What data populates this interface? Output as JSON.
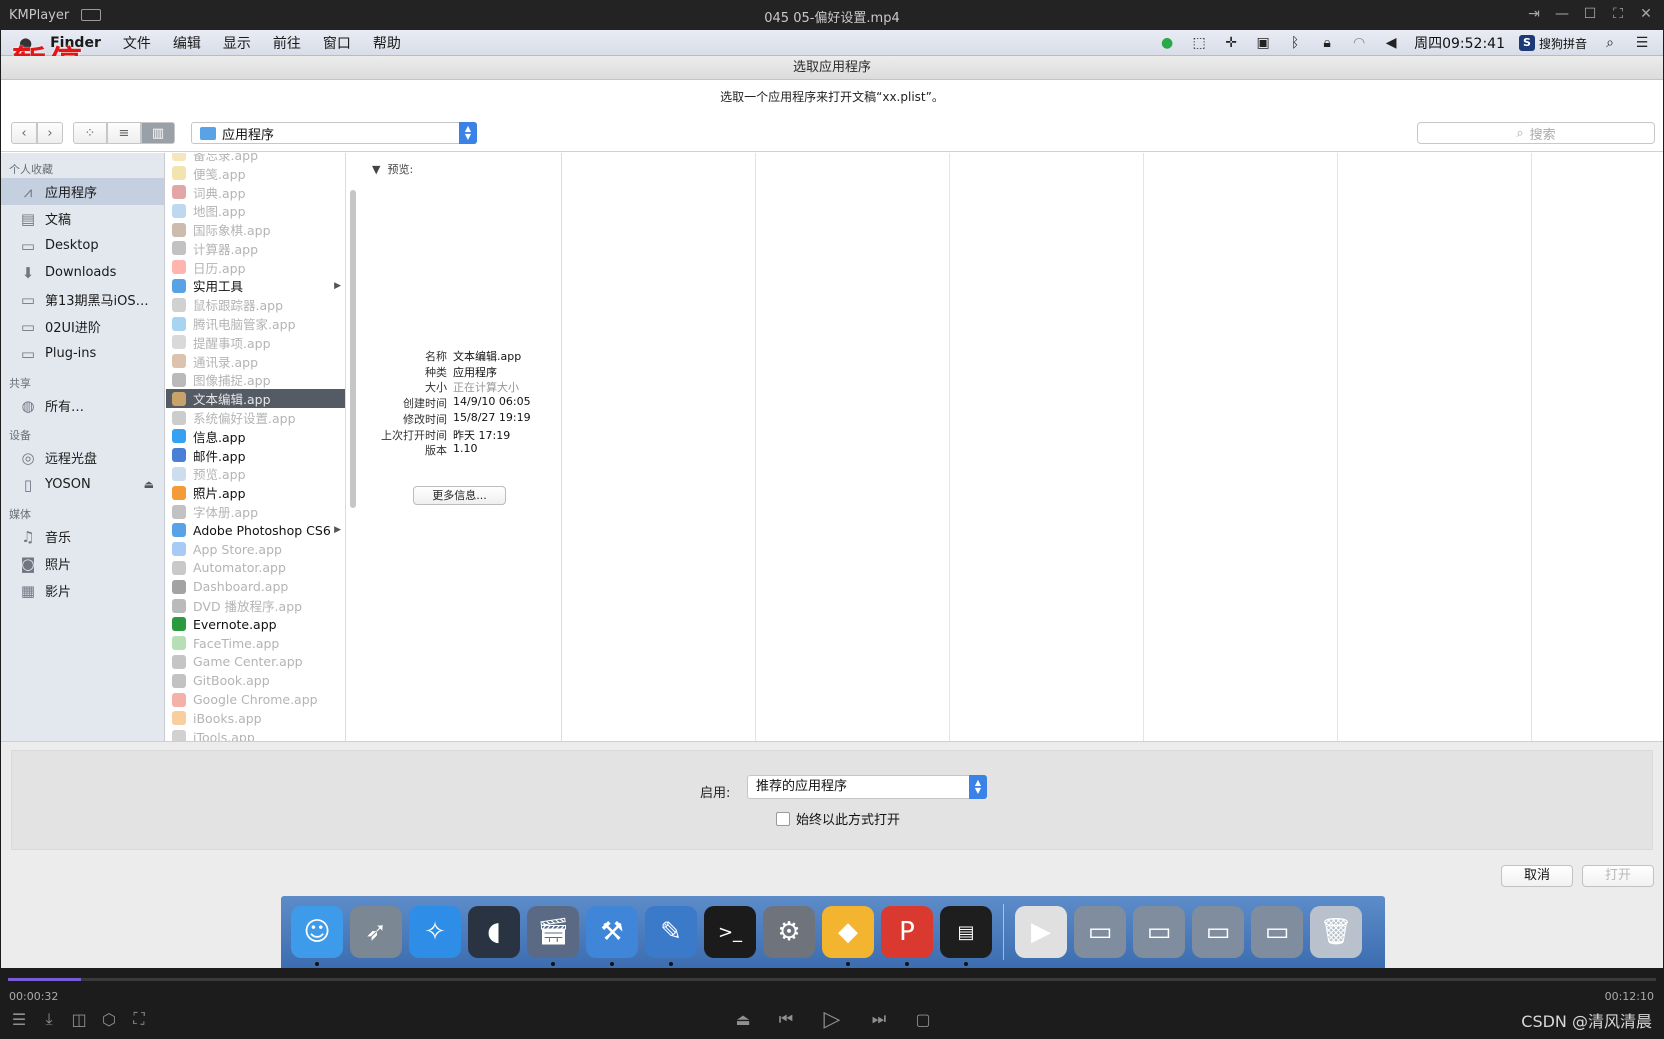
{
  "player": {
    "brand": "KMPlayer",
    "video_title": "045 05-偏好设置.mp4",
    "time_current": "00:00:32",
    "time_total": "00:12:10",
    "progress": 0.044,
    "watermark": "CSDN @清风清晨"
  },
  "overlay": {
    "pause": "暂停"
  },
  "menubar": {
    "app": "Finder",
    "items": [
      "文件",
      "编辑",
      "显示",
      "前往",
      "窗口",
      "帮助"
    ],
    "clock": "周四09:52:41",
    "ime": "搜狗拼音"
  },
  "dialog": {
    "title": "选取应用程序",
    "prompt": "选取一个应用程序来打开文稿“xx.plist”。",
    "location": "应用程序",
    "search_placeholder": "搜索"
  },
  "sidebar": {
    "favorites_header": "个人收藏",
    "favorites": [
      "应用程序",
      "文稿",
      "Desktop",
      "Downloads",
      "第13期黑马iOS…",
      "02UI进阶",
      "Plug-ins"
    ],
    "shared_header": "共享",
    "shared": [
      "所有…"
    ],
    "devices_header": "设备",
    "devices": [
      "远程光盘",
      "YOSON"
    ],
    "media_header": "媒体",
    "media": [
      "音乐",
      "照片",
      "影片"
    ]
  },
  "files": [
    {
      "name": "备忘录.app",
      "dim": true
    },
    {
      "name": "便笺.app",
      "dim": true
    },
    {
      "name": "词典.app",
      "dim": true
    },
    {
      "name": "地图.app",
      "dim": true
    },
    {
      "name": "国际象棋.app",
      "dim": true
    },
    {
      "name": "计算器.app",
      "dim": true
    },
    {
      "name": "日历.app",
      "dim": true
    },
    {
      "name": "实用工具",
      "dim": false,
      "folder": true
    },
    {
      "name": "鼠标跟踪器.app",
      "dim": true
    },
    {
      "name": "腾讯电脑管家.app",
      "dim": true
    },
    {
      "name": "提醒事项.app",
      "dim": true
    },
    {
      "name": "通讯录.app",
      "dim": true
    },
    {
      "name": "图像捕捉.app",
      "dim": true
    },
    {
      "name": "文本编辑.app",
      "dim": false,
      "selected": true
    },
    {
      "name": "系统偏好设置.app",
      "dim": true
    },
    {
      "name": "信息.app",
      "dim": false
    },
    {
      "name": "邮件.app",
      "dim": false
    },
    {
      "name": "预览.app",
      "dim": true
    },
    {
      "name": "照片.app",
      "dim": false
    },
    {
      "name": "字体册.app",
      "dim": true
    },
    {
      "name": "Adobe Photoshop CS6",
      "dim": false,
      "folder": true
    },
    {
      "name": "App Store.app",
      "dim": true
    },
    {
      "name": "Automator.app",
      "dim": true
    },
    {
      "name": "Dashboard.app",
      "dim": true
    },
    {
      "name": "DVD 播放程序.app",
      "dim": true
    },
    {
      "name": "Evernote.app",
      "dim": false
    },
    {
      "name": "FaceTime.app",
      "dim": true
    },
    {
      "name": "Game Center.app",
      "dim": true
    },
    {
      "name": "GitBook.app",
      "dim": true
    },
    {
      "name": "Google Chrome.app",
      "dim": true
    },
    {
      "name": "iBooks.app",
      "dim": true
    },
    {
      "name": "iTools.app",
      "dim": true
    }
  ],
  "preview": {
    "header": "预览:",
    "rows": [
      {
        "k": "名称",
        "v": "文本编辑.app"
      },
      {
        "k": "种类",
        "v": "应用程序"
      },
      {
        "k": "大小",
        "v": "正在计算大小"
      },
      {
        "k": "创建时间",
        "v": "14/9/10 06:05"
      },
      {
        "k": "修改时间",
        "v": "15/8/27 19:19"
      },
      {
        "k": "上次打开时间",
        "v": "昨天 17:19"
      },
      {
        "k": "版本",
        "v": "1.10"
      }
    ],
    "more_button": "更多信息..."
  },
  "options": {
    "enable_label": "启用:",
    "enable_value": "推荐的应用程序",
    "always_label": "始终以此方式打开"
  },
  "buttons": {
    "cancel": "取消",
    "open": "打开"
  },
  "dock": [
    "finder-icon",
    "launchpad-icon",
    "safari-icon",
    "mouse-app-icon",
    "imovie-icon",
    "xcode-icon",
    "instruments-icon",
    "terminal-icon",
    "system-preferences-icon",
    "sketch-icon",
    "wps-icon",
    "console-icon",
    "video-player-icon",
    "screen-icon",
    "screen-icon",
    "screen-icon",
    "screen-icon",
    "trash-icon"
  ]
}
